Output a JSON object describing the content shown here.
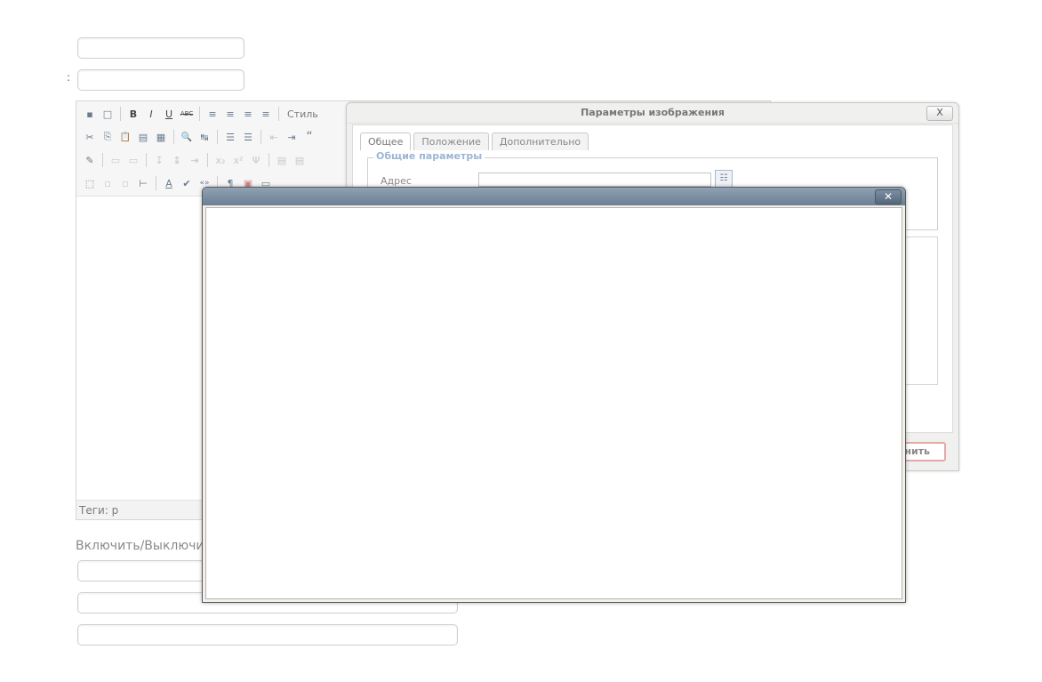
{
  "form": {
    "colon": ":",
    "toggle_label": "Включить/Выключить"
  },
  "toolbar": {
    "style_label": "Стиль",
    "row1": [
      "save-icon",
      "new-document-icon",
      "bold-icon",
      "italic-icon",
      "underline-icon",
      "strikethrough-icon",
      "align-left-icon",
      "align-center-icon",
      "align-right-icon",
      "align-justify-icon"
    ],
    "row1_glyphs": [
      "▪",
      "□",
      "B",
      "I",
      "U",
      "ABC",
      "≡",
      "≡",
      "≡",
      "≡"
    ],
    "row2_glyphs": [
      "✂",
      "⎘",
      "📋",
      "▤",
      "▦",
      "🔍",
      "↹",
      "☰",
      "☰",
      "⇤",
      "⇥",
      "“"
    ],
    "row3_glyphs": [
      "✎",
      "▭",
      "▭",
      "↧",
      "↨",
      "⇥",
      "x₂",
      "x²",
      "Ψ",
      "▤",
      "▤"
    ],
    "row4_glyphs": [
      "⬚",
      "▫",
      "▫",
      "⊢",
      "A",
      "✔",
      "«»",
      "¶",
      "▣",
      "▭"
    ]
  },
  "editor": {
    "tags_label": "Теги: p"
  },
  "image_dialog": {
    "title": "Параметры изображения",
    "close_glyph": "X",
    "tabs": [
      "Общее",
      "Положение",
      "Дополнительно"
    ],
    "legend": "Общие параметры",
    "address_label": "Адрес",
    "address_value": "",
    "browse_glyph": "☷",
    "update_label": "нить"
  },
  "modal": {
    "close_glyph": "✕"
  }
}
